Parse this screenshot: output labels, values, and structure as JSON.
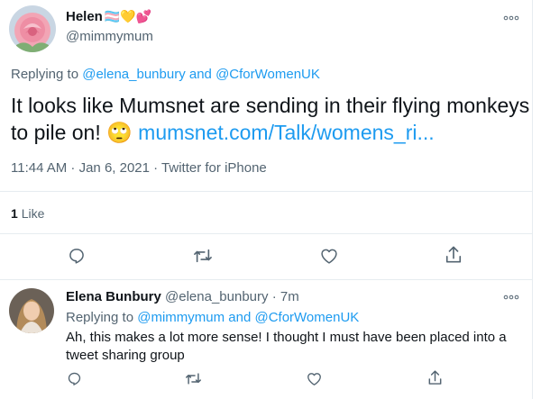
{
  "main_tweet": {
    "author_name": "Helen",
    "author_emoji": "🏳️‍⚧️💛💕",
    "author_handle": "@mimmymum",
    "replying_prefix": "Replying to",
    "replying_to_1": "@elena_bunbury",
    "replying_and": "and",
    "replying_to_2": "@CforWomenUK",
    "text_line1": "It looks like Mumsnet are sending in their flying monkeys",
    "text_line2_prefix": "to pile on!",
    "text_emoji": "🙄",
    "link_text": "mumsnet.com/Talk/womens_ri...",
    "timestamp": "11:44 AM · Jan 6, 2021 · Twitter for iPhone",
    "likes_count": "1",
    "likes_label": "Like"
  },
  "reply_tweet": {
    "author_name": "Elena Bunbury",
    "author_handle": "@elena_bunbury",
    "time_sep": "·",
    "time": "7m",
    "replying_prefix": "Replying to",
    "replying_to_1": "@mimmymum",
    "replying_and": "and",
    "replying_to_2": "@CforWomenUK",
    "text_line1": "Ah, this makes a lot more sense! I thought I must have been placed into a",
    "text_line2": "tweet sharing group"
  },
  "colors": {
    "link": "#1d9bf0",
    "secondary_text": "#536471",
    "divider": "#e6ecf0"
  },
  "icons": [
    "more-icon",
    "reply-icon",
    "retweet-icon",
    "like-icon",
    "share-icon"
  ]
}
